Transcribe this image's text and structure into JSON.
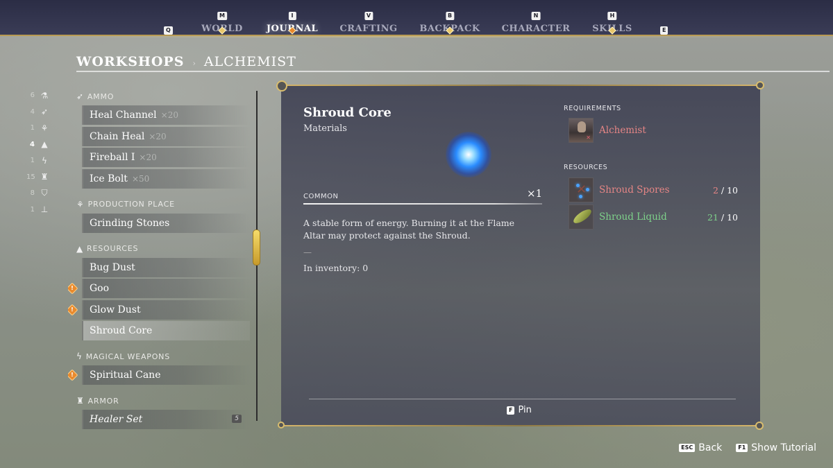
{
  "nav": {
    "left_key": "Q",
    "right_key": "E",
    "tabs": [
      {
        "key": "M",
        "label": "WORLD",
        "active": false,
        "marker": "diamond"
      },
      {
        "key": "I",
        "label": "JOURNAL",
        "active": true,
        "marker": "alert"
      },
      {
        "key": "V",
        "label": "CRAFTING",
        "active": false,
        "marker": "none"
      },
      {
        "key": "B",
        "label": "BACKPACK",
        "active": false,
        "marker": "diamond"
      },
      {
        "key": "N",
        "label": "CHARACTER",
        "active": false,
        "marker": "none"
      },
      {
        "key": "H",
        "label": "SKILLS",
        "active": false,
        "marker": "diamond"
      }
    ]
  },
  "breadcrumb": {
    "main": "WORKSHOPS",
    "separator": "›",
    "sub": "ALCHEMIST"
  },
  "rail": [
    {
      "count": "6",
      "icon": "potion-icon",
      "glyph": "⚗"
    },
    {
      "count": "4",
      "icon": "arrow-icon",
      "glyph": "➶"
    },
    {
      "count": "1",
      "icon": "production-icon",
      "glyph": "⚘"
    },
    {
      "count": "4",
      "icon": "ingots-icon",
      "glyph": "▲",
      "active": true
    },
    {
      "count": "1",
      "icon": "magic-icon",
      "glyph": "ϟ"
    },
    {
      "count": "15",
      "icon": "armor-icon",
      "glyph": "♜"
    },
    {
      "count": "8",
      "icon": "apron-icon",
      "glyph": "⛉"
    },
    {
      "count": "1",
      "icon": "anvil-icon",
      "glyph": "⊥"
    }
  ],
  "sections": [
    {
      "title": "AMMO",
      "icon_glyph": "➶",
      "items": [
        {
          "label": "Heal Channel",
          "qty": "×20"
        },
        {
          "label": "Chain Heal",
          "qty": "×20"
        },
        {
          "label": "Fireball I",
          "qty": "×20"
        },
        {
          "label": "Ice Bolt",
          "qty": "×50"
        }
      ]
    },
    {
      "title": "PRODUCTION PLACE",
      "icon_glyph": "⚘",
      "items": [
        {
          "label": "Grinding Stones"
        }
      ]
    },
    {
      "title": "RESOURCES",
      "icon_glyph": "▲",
      "items": [
        {
          "label": "Bug Dust"
        },
        {
          "label": "Goo",
          "alert": "!"
        },
        {
          "label": "Glow Dust",
          "alert": "!"
        },
        {
          "label": "Shroud Core",
          "selected": true
        }
      ]
    },
    {
      "title": "MAGICAL WEAPONS",
      "icon_glyph": "ϟ",
      "items": [
        {
          "label": "Spiritual Cane",
          "alert": "!"
        }
      ]
    },
    {
      "title": "ARMOR",
      "icon_glyph": "♜",
      "items": [
        {
          "label": "Healer Set",
          "badge": "5"
        }
      ]
    }
  ],
  "detail": {
    "title": "Shroud Core",
    "category": "Materials",
    "rarity": "COMMON",
    "multiplier": "×1",
    "description": "A stable form of energy. Burning it at the Flame Altar may protect against the Shroud.",
    "dash": "—",
    "inventory": "In inventory: 0",
    "requirements_label": "REQUIREMENTS",
    "requirement": {
      "name": "Alchemist",
      "status_color": "#e58585"
    },
    "resources_label": "RESOURCES",
    "resources": [
      {
        "name": "Shroud Spores",
        "have": "2",
        "need": "/ 10",
        "status": "insufficient"
      },
      {
        "name": "Shroud Liquid",
        "have": "21",
        "need": "/ 10",
        "status": "sufficient"
      }
    ],
    "pin": {
      "key": "F",
      "label": "Pin"
    }
  },
  "footer": {
    "back": {
      "key": "ESC",
      "label": "Back"
    },
    "tutorial": {
      "key": "F1",
      "label": "Show Tutorial"
    }
  },
  "colors": {
    "accent_gold": "#d4b46a",
    "alert_orange": "#e98a2d",
    "insufficient": "#e58585",
    "sufficient": "#7ed28a",
    "nav_bg": "#2b2d45"
  }
}
